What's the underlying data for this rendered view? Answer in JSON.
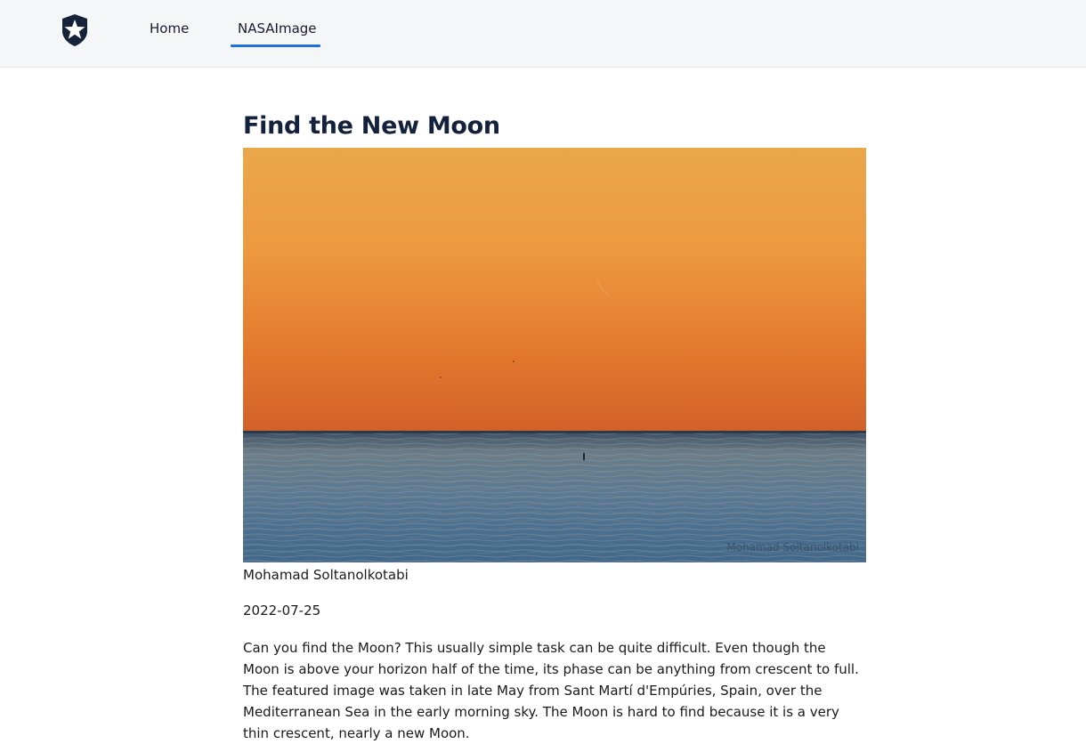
{
  "nav": {
    "logo_icon": "shield-star-icon",
    "home_label": "Home",
    "nasa_label": "NASAImage",
    "active_color": "#1f6fe0"
  },
  "article": {
    "title": "Find the New Moon",
    "image_watermark": "Mohamad Soltanolkotabi",
    "author": "Mohamad Soltanolkotabi",
    "date": "2022-07-25",
    "description": "Can you find the Moon? This usually simple task can be quite difficult. Even though the Moon is above your horizon half of the time, its phase can be anything from crescent to full. The featured image was taken in late May from Sant Martí d'Empúries, Spain, over the Mediterranean Sea in the early morning sky. The Moon is hard to find because it is a very thin crescent, nearly a new Moon."
  }
}
